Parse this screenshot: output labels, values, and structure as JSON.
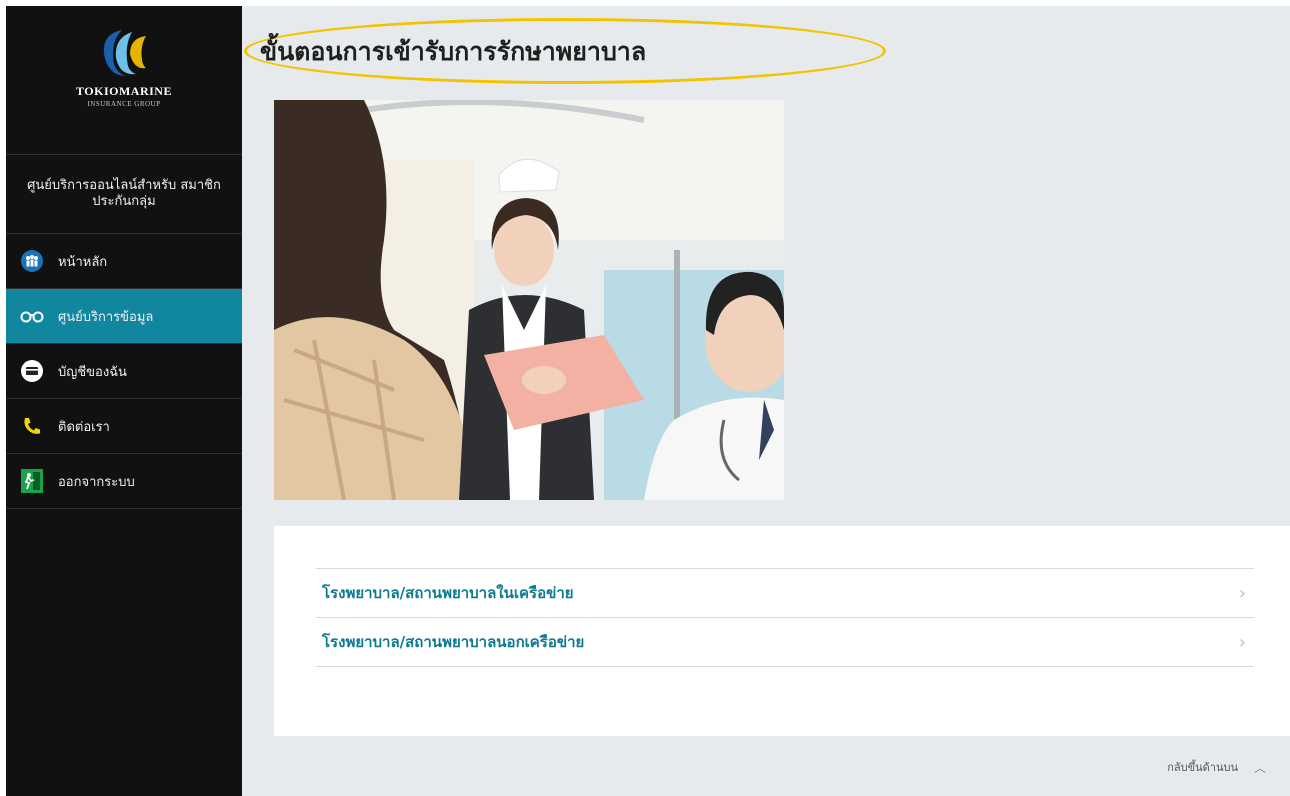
{
  "brand": {
    "name": "TOKIOMARINE",
    "sub": "INSURANCE GROUP",
    "colors": {
      "blue": "#1a5fa8",
      "sky": "#6ec0e6",
      "gold": "#e6b400"
    }
  },
  "sidebar": {
    "center_name": "ศูนย์บริการออนไลน์สำหรับ สมาชิกประกันกลุ่ม",
    "items": [
      {
        "label": "หน้าหลัก",
        "icon": "family-icon",
        "active": false
      },
      {
        "label": "ศูนย์บริการข้อมูล",
        "icon": "glasses-icon",
        "active": true
      },
      {
        "label": "บัญชีของฉัน",
        "icon": "card-icon",
        "active": false
      },
      {
        "label": "ติดต่อเรา",
        "icon": "phone-icon",
        "active": false
      },
      {
        "label": "ออกจากระบบ",
        "icon": "exit-icon",
        "active": false
      }
    ],
    "active_color": "#10869f"
  },
  "main": {
    "title": "ขั้นตอนการเข้ารับการรักษาพยาบาล",
    "highlight_color": "#f3c300",
    "hero_image": "nurse-with-patient-photo",
    "links": [
      {
        "label": "โรงพยาบาล/สถานพยาบาลในเครือข่าย",
        "icon": "chevron-right-icon"
      },
      {
        "label": "โรงพยาบาล/สถานพยาบาลนอกเครือข่าย",
        "icon": "chevron-right-icon"
      }
    ],
    "back_to_top": "กลับขึ้นด้านบน"
  }
}
